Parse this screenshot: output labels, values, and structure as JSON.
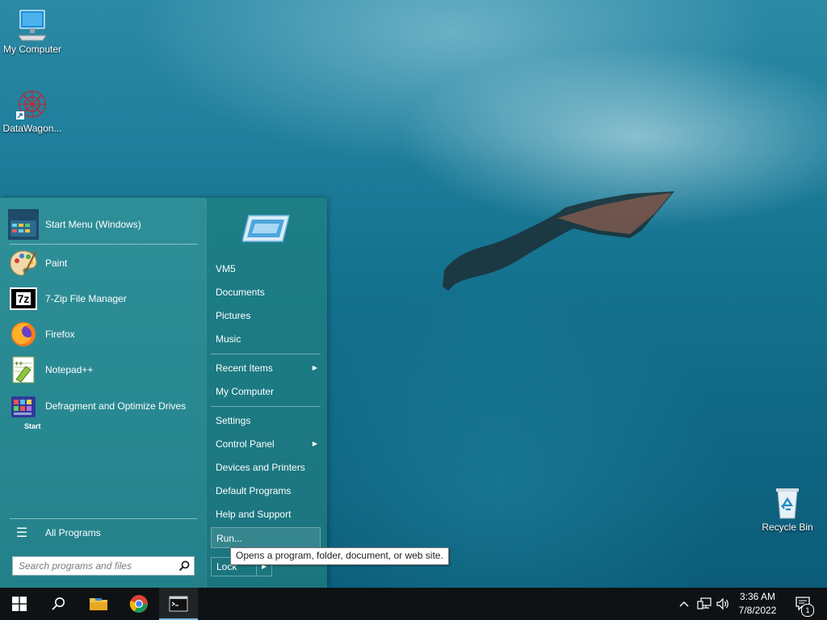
{
  "desktop": {
    "icons": [
      {
        "label": "My Computer",
        "icon": "monitor-icon"
      },
      {
        "label": "DataWagon...",
        "icon": "datawagon-icon"
      },
      {
        "label": "Recycle Bin",
        "icon": "recycle-bin-icon"
      }
    ]
  },
  "start_menu": {
    "pinned": {
      "label": "Start Menu (Windows)",
      "icon": "start-menu-app-icon",
      "icon_text": "Start"
    },
    "programs": [
      {
        "label": "Paint",
        "icon": "paint-palette-icon"
      },
      {
        "label": "7-Zip File Manager",
        "icon": "7zip-icon",
        "icon_text": "7z"
      },
      {
        "label": "Firefox",
        "icon": "firefox-icon"
      },
      {
        "label": "Notepad++",
        "icon": "notepad-plus-plus-icon"
      },
      {
        "label": "Defragment and Optimize Drives",
        "icon": "defrag-icon"
      }
    ],
    "all_programs": "All Programs",
    "search": {
      "placeholder": "Search programs and files"
    },
    "right": {
      "group1": [
        "VM5",
        "Documents",
        "Pictures",
        "Music"
      ],
      "group2": [
        "Recent Items",
        "My Computer"
      ],
      "group3": [
        "Settings",
        "Control Panel",
        "Devices and Printers",
        "Default Programs",
        "Help and Support"
      ],
      "run": "Run...",
      "lock": "Lock"
    },
    "tooltip": "Opens a program, folder, document, or web site."
  },
  "taskbar": {
    "time": "3:36 AM",
    "date": "7/8/2022",
    "notification_count": "1",
    "accent": "#7ab7e0"
  }
}
